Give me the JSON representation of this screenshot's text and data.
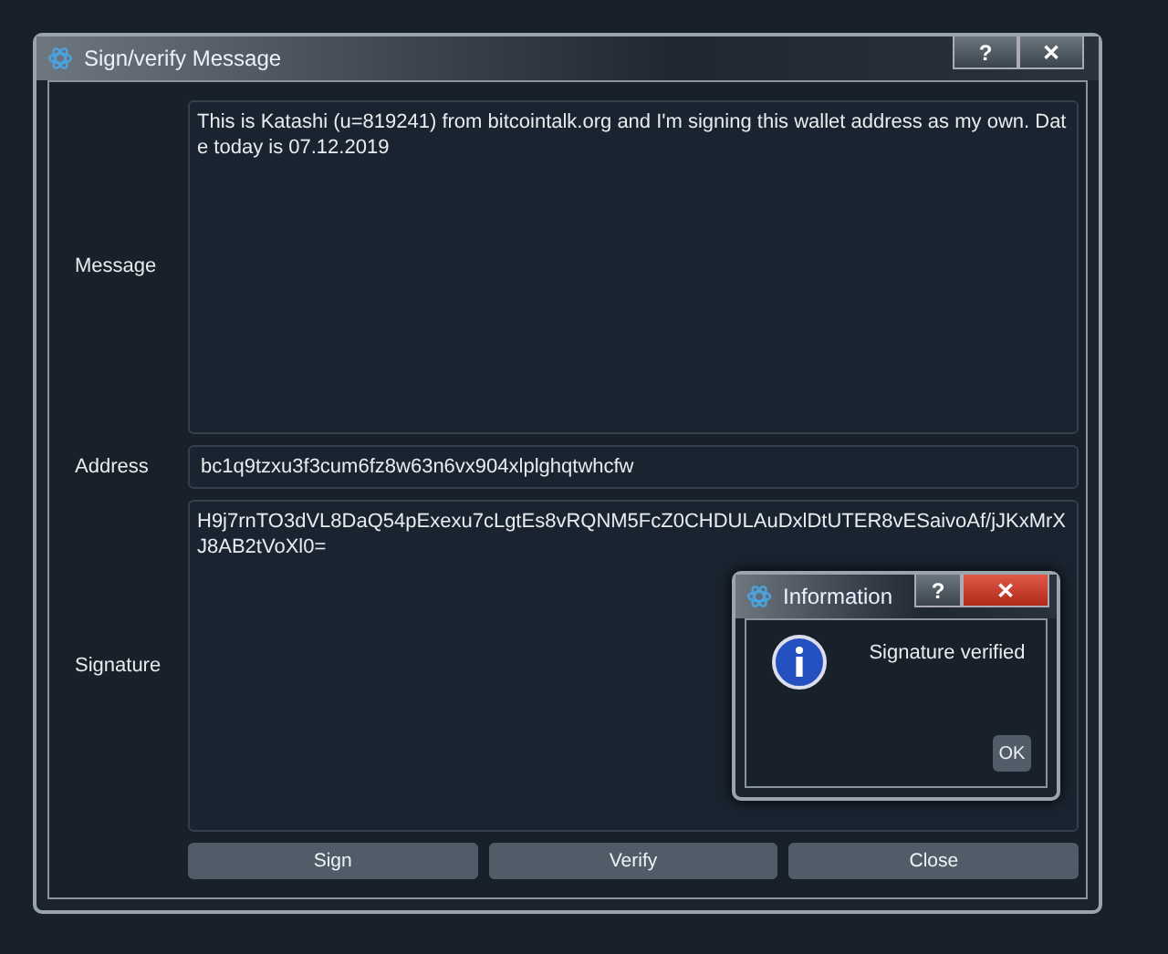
{
  "window": {
    "title": "Sign/verify Message",
    "buttons": [
      "?",
      "✕"
    ]
  },
  "fields": [
    {
      "label": "Message",
      "value": "This is Katashi (u=819241) from bitcointalk.org and I'm signing this wallet address as my own. Date today is 07.12.2019",
      "kind": "area"
    },
    {
      "label": "Address",
      "value": "bc1q9tzxu3f3cum6fz8w63n6vx904xlplghqtwhcfw",
      "kind": "line"
    },
    {
      "label": "Signature",
      "value": "H9j7rnTO3dVL8DaQ54pExexu7cLgtEs8vRQNM5FcZ0CHDULAuDxlDtUTER8vESaivoAf/jJKxMrXJ8AB2tVoXl0=",
      "kind": "area"
    }
  ],
  "buttons": [
    "Sign",
    "Verify",
    "Close"
  ],
  "dialog": {
    "title": "Information",
    "buttons": [
      "?",
      "✕"
    ],
    "message": "Signature verified",
    "ok": "OK"
  }
}
